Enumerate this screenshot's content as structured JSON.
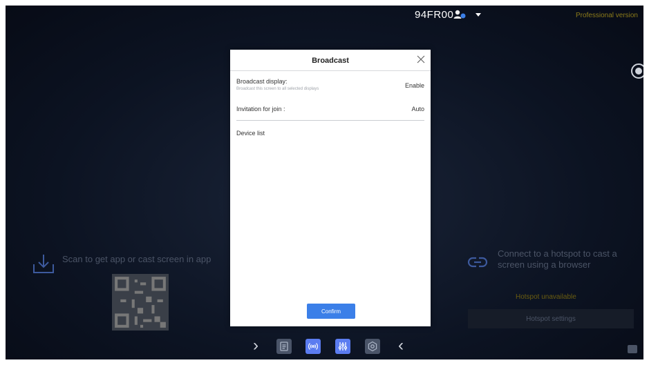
{
  "topbar": {
    "device_name": "94FR00",
    "edition": "Professional version",
    "user_icon": "user-icon",
    "dropdown_icon": "caret-down-icon"
  },
  "left_panel": {
    "icon": "download-icon",
    "scan_text": "Scan to get app or cast screen in app"
  },
  "right_panel": {
    "icon": "link-icon",
    "hotspot_text": "Connect to a hotspot to cast a screen using a browser",
    "hotspot_status": "Hotspot unavailable",
    "hotspot_button": "Hotspot settings"
  },
  "modal": {
    "title": "Broadcast",
    "broadcast_label": "Broadcast display:",
    "broadcast_sub": "Broadcast this screen to all selected displays",
    "broadcast_value": "Enable",
    "invitation_label": "Invitation for join :",
    "invitation_value": "Auto",
    "device_list_label": "Device list",
    "confirm_label": "Confirm"
  },
  "dock": {
    "items": [
      "chevron-right-icon",
      "document-icon",
      "broadcast-icon",
      "equalizer-icon",
      "settings-icon",
      "chevron-left-icon"
    ]
  },
  "colors": {
    "accent": "#3b7fe8",
    "dock_button": "#5b7cf0",
    "warning_text": "#8c7b1a",
    "background_dark": "#0c1322"
  }
}
